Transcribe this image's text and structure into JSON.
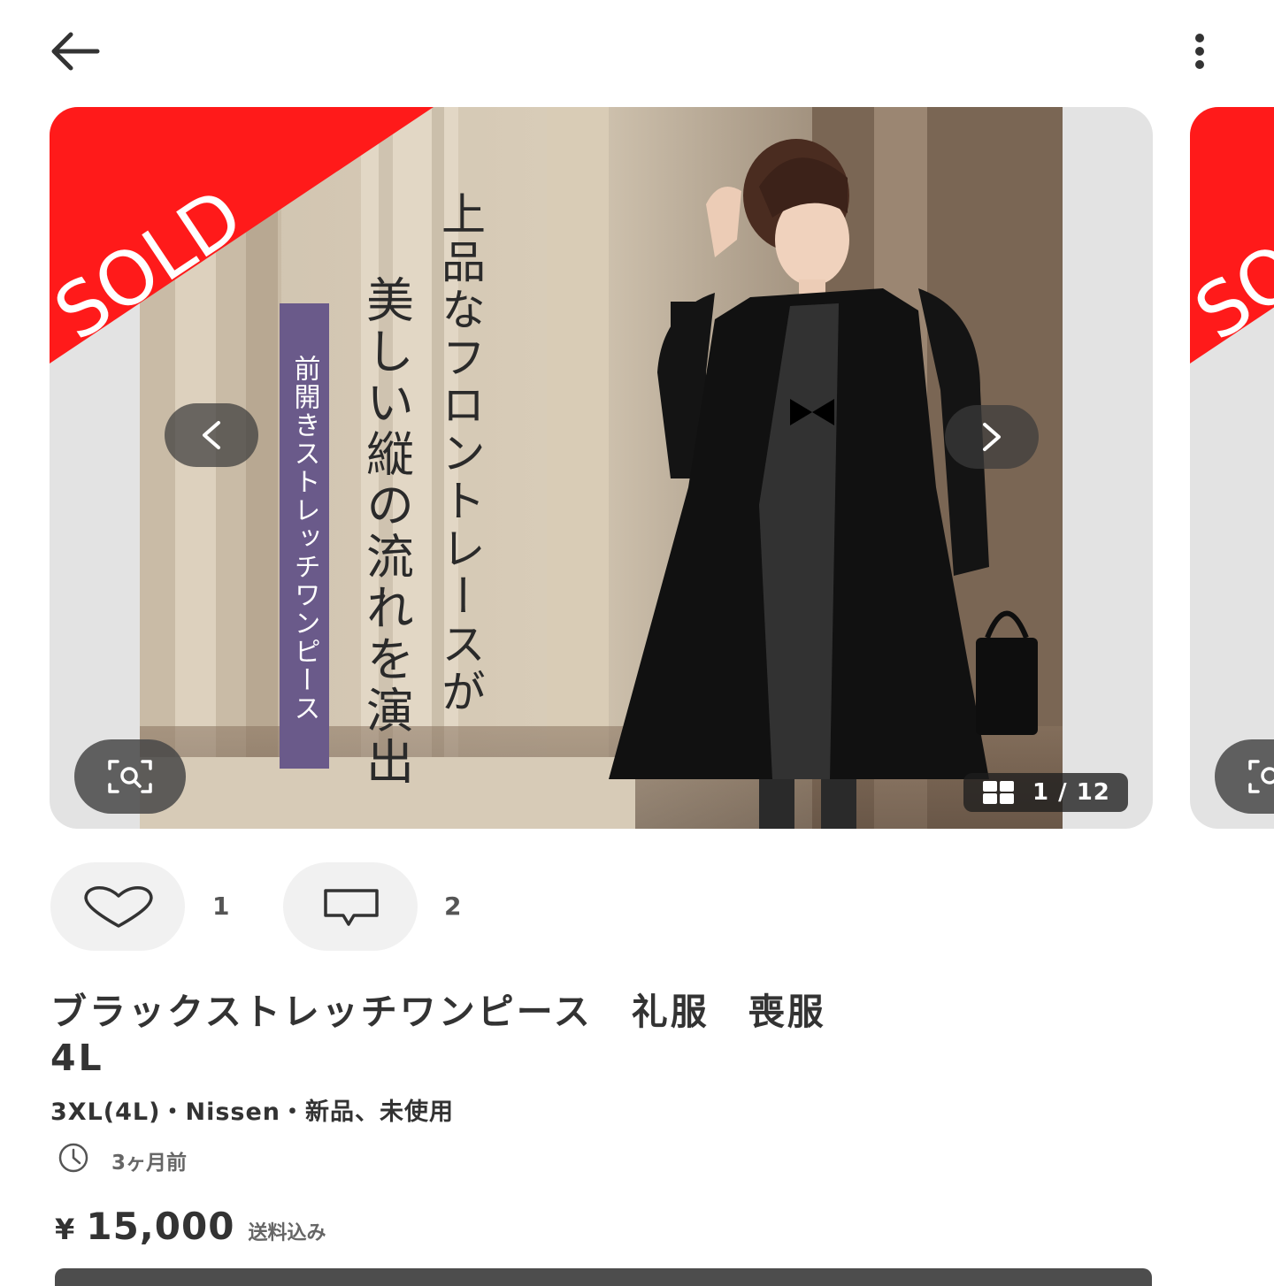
{
  "header": {
    "back_icon": "arrow-left-icon",
    "more_icon": "more-vertical-icon"
  },
  "gallery": {
    "sold_label": "SOLD",
    "counter": "1 / 12",
    "photo_text": {
      "headline_line1": "上品なフロントレースが",
      "headline_line2": "美しい縦の流れを演出",
      "badge": "前開きストレッチワンピース"
    },
    "colors": {
      "sold": "#ff1a1a",
      "badge": "#6a5a8a"
    },
    "icons": {
      "prev": "chevron-left-icon",
      "next": "chevron-right-icon",
      "image_search": "image-search-icon",
      "grid": "grid-icon"
    }
  },
  "actions": {
    "like_icon": "heart-icon",
    "like_count": "1",
    "comment_icon": "comment-icon",
    "comment_count": "2"
  },
  "item": {
    "title": "ブラックストレッチワンピース　礼服　喪服\n4L",
    "meta": "3XL(4L)・Nissen・新品、未使用",
    "time_icon": "clock-icon",
    "posted": "3ヶ月前",
    "currency": "¥",
    "price": "15,000",
    "shipping": "送料込み"
  }
}
